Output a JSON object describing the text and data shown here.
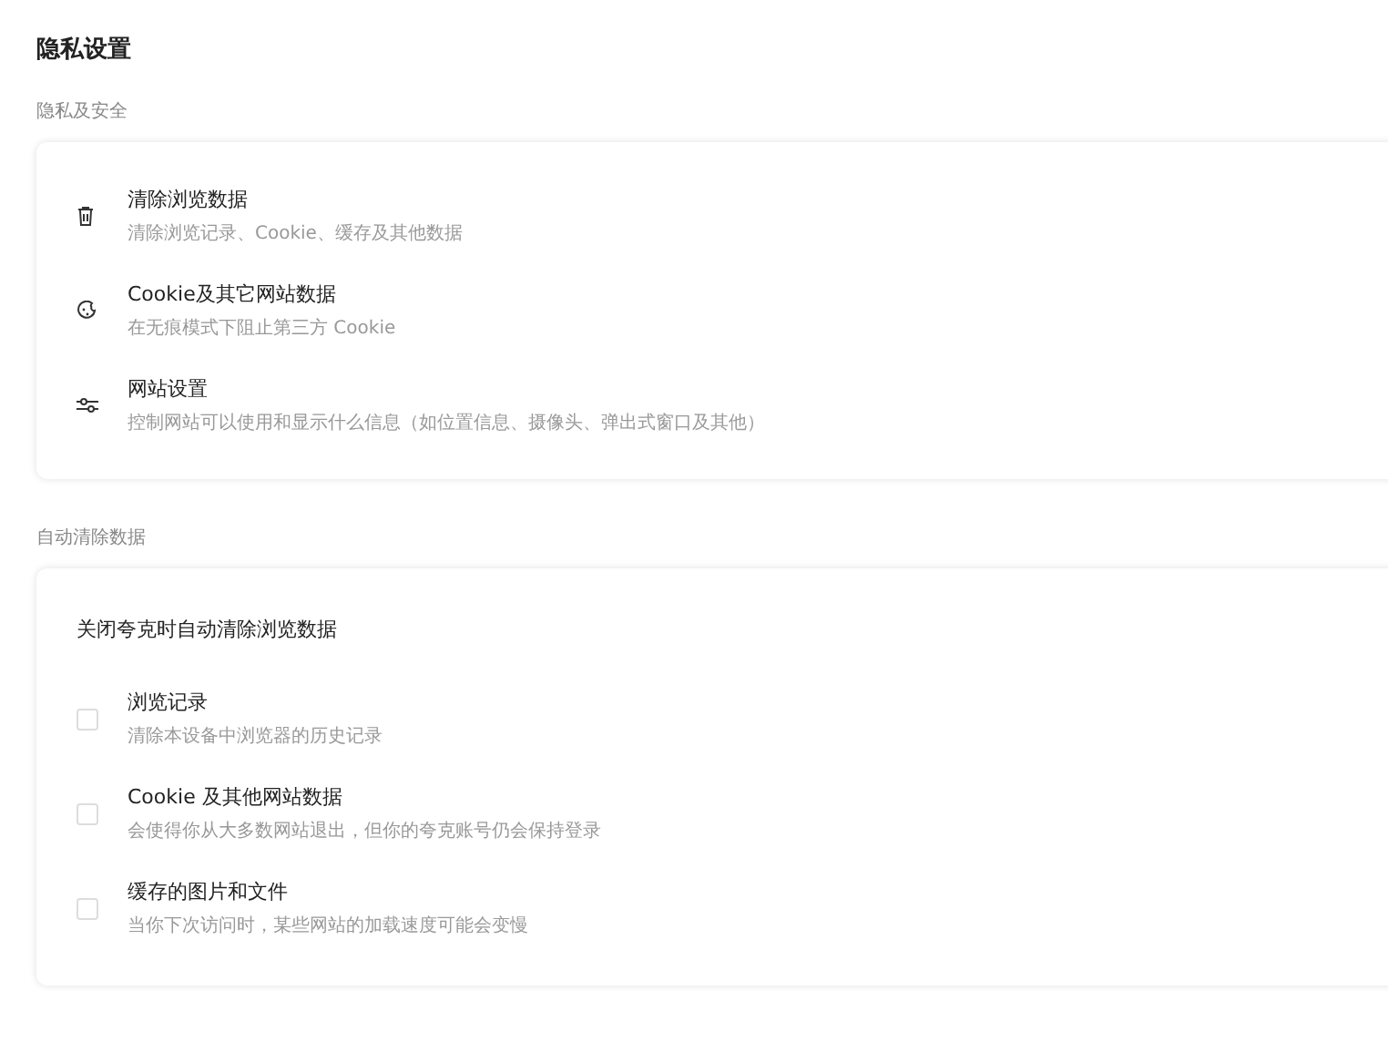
{
  "page_title": "隐私设置",
  "privacy_section": {
    "label": "隐私及安全",
    "items": [
      {
        "title": "清除浏览数据",
        "description": "清除浏览记录、Cookie、缓存及其他数据"
      },
      {
        "title": "Cookie及其它网站数据",
        "description": "在无痕模式下阻止第三方 Cookie"
      },
      {
        "title": "网站设置",
        "description": "控制网站可以使用和显示什么信息（如位置信息、摄像头、弹出式窗口及其他）"
      }
    ]
  },
  "auto_clear_section": {
    "label": "自动清除数据",
    "heading": "关闭夸克时自动清除浏览数据",
    "options": [
      {
        "title": "浏览记录",
        "description": "清除本设备中浏览器的历史记录",
        "checked": false
      },
      {
        "title": "Cookie 及其他网站数据",
        "description": "会使得你从大多数网站退出，但你的夸克账号仍会保持登录",
        "checked": false
      },
      {
        "title": "缓存的图片和文件",
        "description": "当你下次访问时，某些网站的加载速度可能会变慢",
        "checked": false
      }
    ]
  }
}
